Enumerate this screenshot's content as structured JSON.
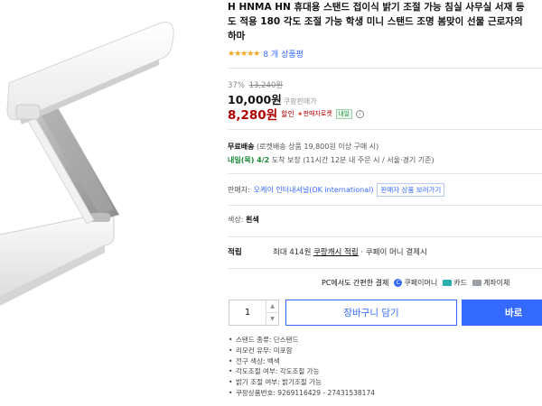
{
  "product": {
    "title_lines": [
      "H HNMA HN 휴대용 스탠드 접이식 밝기 조절 가능 침실 사무실 서재 등",
      "도 적용 180 각도 조절 가능 학생 미니 스탠드 조명 봄맞이 선물 근로자의",
      "하마"
    ],
    "rating_stars": "★★★★★",
    "review_count": "8 개 상품평"
  },
  "price": {
    "discount_rate": "37%",
    "original_price": "13,240원",
    "sale_price": "10,000원",
    "sale_label": "쿠팡판매가",
    "coupon_price": "8,280원",
    "coupon_label": "할인",
    "seller_badge": "판매자로켓",
    "tomorrow_badge": "내일",
    "info_glyph": "i"
  },
  "shipping": {
    "label": "무료배송",
    "detail": "(로켓배송 상품 19,800원 이상 구매 시)",
    "arrival_date": "내일(목) 4/2",
    "arrival_label": "도착 보장",
    "arrival_detail": "(11시간 12분 내 주문 시 / 서울⋅경기 기준)"
  },
  "seller": {
    "label": "판매자:",
    "name": "오케이 인터내셔널(OK international)",
    "button": "판매자 상품 보러가기"
  },
  "option": {
    "label": "색상:",
    "value": "흰색"
  },
  "points": {
    "label": "적립",
    "prefix": "최대 414원",
    "link": "쿠팡캐시 적립",
    "suffix": "· 쿠페이 머니 결제시"
  },
  "payment": {
    "intro": "PC에서도 간편한 결제",
    "coupay_glyph": "C",
    "coupay": "쿠페이머니",
    "card": "카드",
    "account": "계좌이체"
  },
  "purchase": {
    "quantity": "1",
    "up_arrow": "▲",
    "down_arrow": "▼",
    "cart_button": "장바구니 담기",
    "buy_button": "바로"
  },
  "specs": [
    "스탠드 종류: 단스탠드",
    "리모컨 유무: 미포함",
    "전구 색상: 백색",
    "각도조절 여부: 각도조절 가능",
    "밝기 조절 여부: 밝기조절 가능",
    "쿠팡상품번호: 9269116429 - 27431538174"
  ],
  "colors": {
    "accent_blue": "#346aff",
    "coupon_red": "#ae0000",
    "arrival_green": "#1a8a3a"
  }
}
